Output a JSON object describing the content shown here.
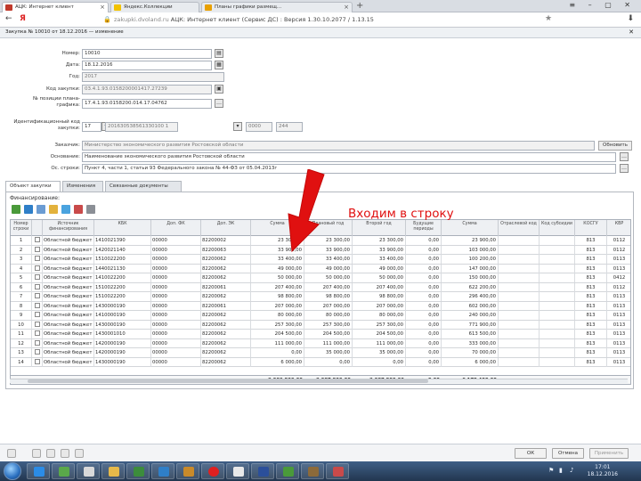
{
  "browser": {
    "tabs": [
      {
        "label": "АЦК: Интернет клиент",
        "active": true
      },
      {
        "label": "Яндекс.Коллекции"
      },
      {
        "label": "Планы графики размещ..."
      }
    ],
    "url_host": "zakupki.dvoland.ru",
    "url_title": "АЦК: Интернет клиент (Сервис ДС) : Версия 1.30.10.2077 / 1.13.15",
    "back_glyph": "←",
    "yandex_glyph": "Я"
  },
  "doc": {
    "title": "Закупка № 10010 от 18.12.2016 — изменение",
    "close": "✕"
  },
  "form": {
    "number_label": "Номер:",
    "number_value": "10010",
    "date_label": "Дата:",
    "date_value": "18.12.2016",
    "year_label": "Год:",
    "year_value": "2017",
    "code_label": "Код закупки:",
    "code_value": "03.4.1.93.0158200001417.27239",
    "plan_label": "№ позиции плана-графика:",
    "plan_value": "17.4.1.93.0158200.014.17.04762",
    "ikz_label": "Идентификационный код закупки:",
    "ikz_part1": "17",
    "ikz_part2": "201630538561330100 1",
    "ikz_part3": "0000",
    "ikz_part4": "244",
    "customer_label": "Заказчик:",
    "customer_value": "Министерство экономического развития Ростовской области",
    "customer_btn": "Обновить",
    "reason_label": "Основание:",
    "reason_value": "Наименование экономического развития Ростовской области",
    "grounds_label": "Ос. строки:",
    "grounds_value": "Пункт 4, части 1, статьи 93 Федерального закона № 44-ФЗ от 05.04.2013г"
  },
  "tabs": [
    {
      "label": "Объект закупки",
      "active": true
    },
    {
      "label": "Изменения"
    },
    {
      "label": "Связанные документы"
    }
  ],
  "panel_label": "Финансирование:",
  "grid": {
    "headers": [
      "Номер строки",
      "",
      "Источник финансирования",
      "КБК",
      "Доп. ФК",
      "Доп. ЭК",
      "Сумма",
      "Плановый год",
      "Второй год",
      "Будущие периоды",
      "Сумма",
      "Отраслевой код",
      "Код субсидии",
      "КОСГУ",
      "КВР"
    ],
    "rows": [
      [
        "1",
        "Областной бюджет",
        "1410021390",
        "00000",
        "82200002",
        "23 300,00",
        "23 300,00",
        "23 300,00",
        "0,00",
        "23 900,00",
        "813",
        "0112"
      ],
      [
        "2",
        "Областной бюджет",
        "1420021140",
        "00000",
        "82200063",
        "33 900,00",
        "33 900,00",
        "33 900,00",
        "0,00",
        "103 000,00",
        "813",
        "0112"
      ],
      [
        "3",
        "Областной бюджет",
        "1510022200",
        "00000",
        "82200062",
        "33 400,00",
        "33 400,00",
        "33 400,00",
        "0,00",
        "100 200,00",
        "813",
        "0113"
      ],
      [
        "4",
        "Областной бюджет",
        "1440021130",
        "00000",
        "82200062",
        "49 000,00",
        "49 000,00",
        "49 000,00",
        "0,00",
        "147 000,00",
        "813",
        "0113"
      ],
      [
        "5",
        "Областной бюджет",
        "1410022200",
        "00000",
        "82200062",
        "50 000,00",
        "50 000,00",
        "50 000,00",
        "0,00",
        "150 000,00",
        "813",
        "0412"
      ],
      [
        "6",
        "Областной бюджет",
        "1510022200",
        "00000",
        "82200061",
        "207 400,00",
        "207 400,00",
        "207 400,00",
        "0,00",
        "622 200,00",
        "813",
        "0112"
      ],
      [
        "7",
        "Областной бюджет",
        "1510022200",
        "00000",
        "82200062",
        "98 800,00",
        "98 800,00",
        "98 800,00",
        "0,00",
        "296 400,00",
        "813",
        "0113"
      ],
      [
        "8",
        "Областной бюджет",
        "1430000190",
        "00000",
        "82200061",
        "207 000,00",
        "207 000,00",
        "207 000,00",
        "0,00",
        "602 000,00",
        "813",
        "0113"
      ],
      [
        "9",
        "Областной бюджет",
        "1410000190",
        "00000",
        "82200062",
        "80 000,00",
        "80 000,00",
        "80 000,00",
        "0,00",
        "240 000,00",
        "813",
        "0113"
      ],
      [
        "10",
        "Областной бюджет",
        "1430000190",
        "00000",
        "82200062",
        "257 300,00",
        "257 300,00",
        "257 300,00",
        "0,00",
        "771 900,00",
        "813",
        "0113"
      ],
      [
        "11",
        "Областной бюджет",
        "1430001010",
        "00000",
        "82200062",
        "204 500,00",
        "204 500,00",
        "204 500,00",
        "0,00",
        "613 500,00",
        "813",
        "0113"
      ],
      [
        "12",
        "Областной бюджет",
        "1420000190",
        "00000",
        "82200062",
        "111 000,00",
        "111 000,00",
        "111 000,00",
        "0,00",
        "333 000,00",
        "813",
        "0113"
      ],
      [
        "13",
        "Областной бюджет",
        "1420000190",
        "00000",
        "82200062",
        "0,00",
        "35 000,00",
        "35 000,00",
        "0,00",
        "70 000,00",
        "813",
        "0113"
      ],
      [
        "14",
        "Областной бюджет",
        "1430000190",
        "00000",
        "82200062",
        "6 000,00",
        "0,00",
        "0,00",
        "0,00",
        "6 000,00",
        "813",
        "0113"
      ]
    ],
    "totals": [
      "2 002 800,00",
      "2 087 800,00",
      "2 087 800,00",
      "0,00",
      "6 178 400,00"
    ]
  },
  "annotation": "Входим в строку",
  "annotation_color": "#e01010",
  "bottom": {
    "ok": "ОК",
    "cancel": "Отмена",
    "apply": "Применить"
  },
  "taskbar": {
    "time": "17:01",
    "date": "18.12.2016"
  }
}
